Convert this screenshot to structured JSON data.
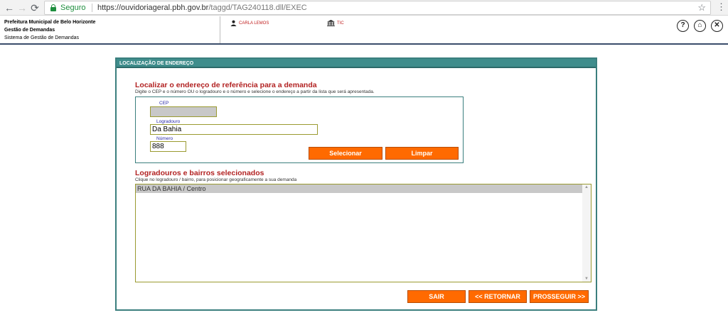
{
  "browser": {
    "secure_label": "Seguro",
    "url_domain": "https://ouvidoriageral.pbh.gov.br",
    "url_path": "/taggd/TAG240118.dll/EXEC"
  },
  "header": {
    "org_line1": "Prefeitura Municipal de Belo Horizonte",
    "org_line2": "Gestão de Demandas",
    "org_line3": "Sistema de Gestão de Demandas",
    "user_name": "CARLA LEMOS",
    "unit_name": "TIC",
    "help_label": "?",
    "home_label": "⌂",
    "close_label": "✕"
  },
  "panel": {
    "title": "LOCALIZAÇÃO DE ENDEREÇO",
    "search_title": "Localizar o endereço de referência para a demanda",
    "search_hint": "Digite o CEP e o número OU o logradouro e o número e selecione o endereço a partir da lista que será apresentada.",
    "cep_label": "CEP",
    "cep_value": "",
    "logradouro_label": "Logradouro",
    "logradouro_value": "Da Bahia",
    "numero_label": "Número",
    "numero_value": "888",
    "select_button": "Selecionar",
    "clear_button": "Limpar",
    "results_title": "Logradouros e bairros selecionados",
    "results_hint": "Clique no logradouro / bairro, para posicionar geograficamente a sua demanda",
    "results": [
      "RUA DA BAHIA / Centro"
    ],
    "exit_button": "SAIR",
    "back_button": "<< RETORNAR",
    "next_button": "PROSSEGUIR >>"
  }
}
